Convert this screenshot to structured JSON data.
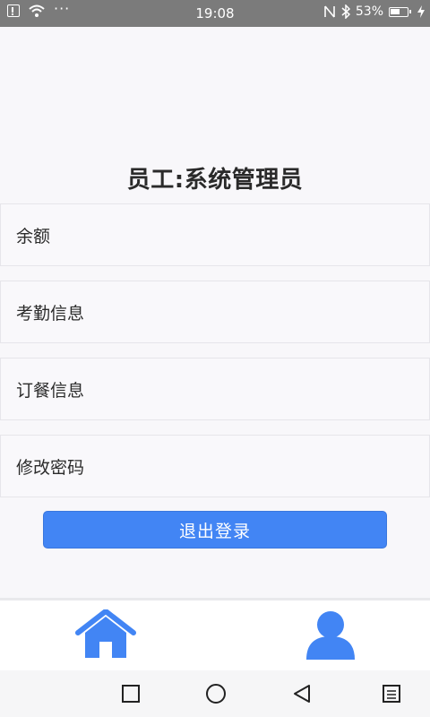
{
  "status_bar": {
    "time": "19:08",
    "battery": "53%",
    "icons": [
      "alert-icon",
      "wifi-icon",
      "more-dots-icon",
      "nfc-icon",
      "bluetooth-icon",
      "battery-icon",
      "charging-icon"
    ]
  },
  "page": {
    "title": "员工:系统管理员"
  },
  "menu": {
    "items": [
      {
        "label": "余额"
      },
      {
        "label": "考勤信息"
      },
      {
        "label": "订餐信息"
      },
      {
        "label": "修改密码"
      }
    ]
  },
  "logout": {
    "label": "退出登录"
  },
  "tab_bar": {
    "items": [
      {
        "icon": "home-icon"
      },
      {
        "icon": "user-icon"
      }
    ],
    "accent": "#4285f4"
  },
  "nav_bar": {
    "icons": [
      "square-recents-icon",
      "circle-home-icon",
      "triangle-back-icon",
      "menu-icon"
    ]
  }
}
